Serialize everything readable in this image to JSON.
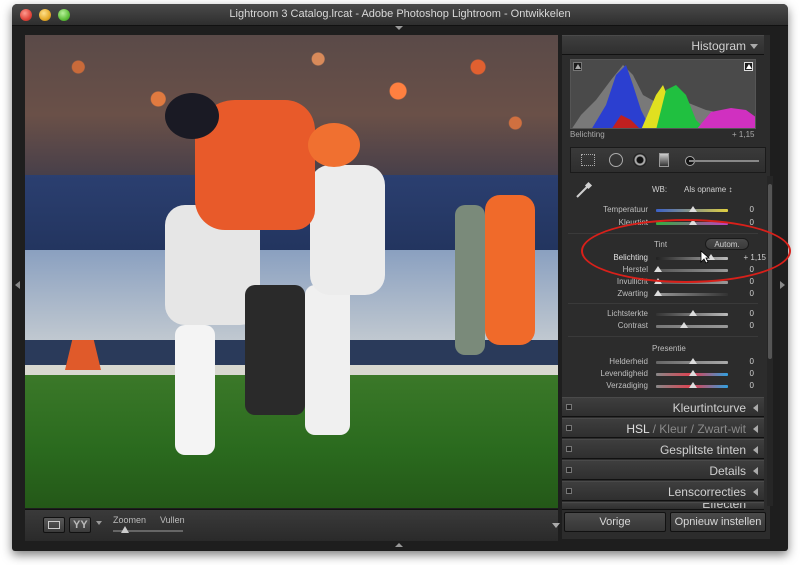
{
  "window": {
    "title": "Lightroom 3 Catalog.lrcat - Adobe Photoshop Lightroom - Ontwikkelen"
  },
  "toolbar": {
    "yy_label": "YY",
    "zoom_label": "Zoomen",
    "fill_label": "Vullen"
  },
  "panels": {
    "histogram": {
      "label": "Histogram",
      "readout_label": "Belichting",
      "readout_value": "+ 1,15"
    },
    "basic": {
      "wb_label": "WB:",
      "wb_value": "Als opname ↕",
      "temp_label": "Temperatuur",
      "temp_value": "0",
      "tint_wb_label": "Kleurtint",
      "tint_wb_value": "0",
      "tone_label": "Tint",
      "auto_label": "Autom.",
      "exposure_label": "Belichting",
      "exposure_value": "+ 1,15",
      "recovery_label": "Herstel",
      "recovery_value": "0",
      "fill_light_label": "Invullicht",
      "fill_light_value": "0",
      "blacks_label": "Zwarting",
      "blacks_value": "0",
      "brightness_label": "Lichtsterkte",
      "brightness_value": "0",
      "contrast_label": "Contrast",
      "contrast_value": "0",
      "presence_label": "Presentie",
      "clarity_label": "Helderheid",
      "clarity_value": "0",
      "vibrance_label": "Levendigheid",
      "vibrance_value": "0",
      "saturation_label": "Verzadiging",
      "saturation_value": "0"
    },
    "tone_curve": {
      "label": "Kleurtintcurve"
    },
    "hsl": {
      "a": "HSL",
      "b": "Kleur",
      "c": "Zwart-wit",
      "sep": "/"
    },
    "split_toning": {
      "label": "Gesplitste tinten"
    },
    "details": {
      "label": "Details"
    },
    "lens": {
      "label": "Lenscorrecties"
    },
    "effects": {
      "label": "Effecten"
    }
  },
  "buttons": {
    "previous": "Vorige",
    "reset": "Opnieuw instellen"
  },
  "colors": {
    "accent": "#d8201a",
    "panel": "#2c2c2c"
  }
}
